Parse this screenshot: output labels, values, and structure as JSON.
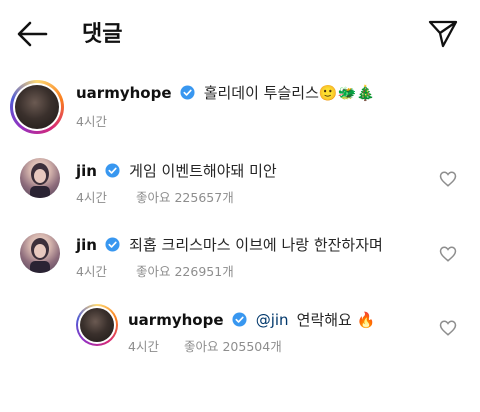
{
  "header": {
    "title": "댓글"
  },
  "caption": {
    "username": "uarmyhope",
    "text": "홀리데이 투슬리스🙂🐲🎄",
    "time": "4시간"
  },
  "comments": [
    {
      "username": "jin",
      "text": "게임 이벤트해야돼 미안",
      "time": "4시간",
      "likes": "좋아요 225657개"
    },
    {
      "username": "jin",
      "text": "죄홉 크리스마스 이브에 나랑 한잔하자며",
      "time": "4시간",
      "likes": "좋아요 226951개"
    }
  ],
  "reply": {
    "username": "uarmyhope",
    "mention": "@jin",
    "text": "연락해요 🔥",
    "time": "4시간",
    "likes": "좋아요 205504개"
  },
  "icons": {
    "back": "arrow-left-icon",
    "send": "paper-plane-icon",
    "verified": "verified-badge-icon",
    "like": "heart-outline-icon"
  },
  "colors": {
    "verified": "#3897f0",
    "mention": "#00376b",
    "meta": "#8e8e8e"
  }
}
